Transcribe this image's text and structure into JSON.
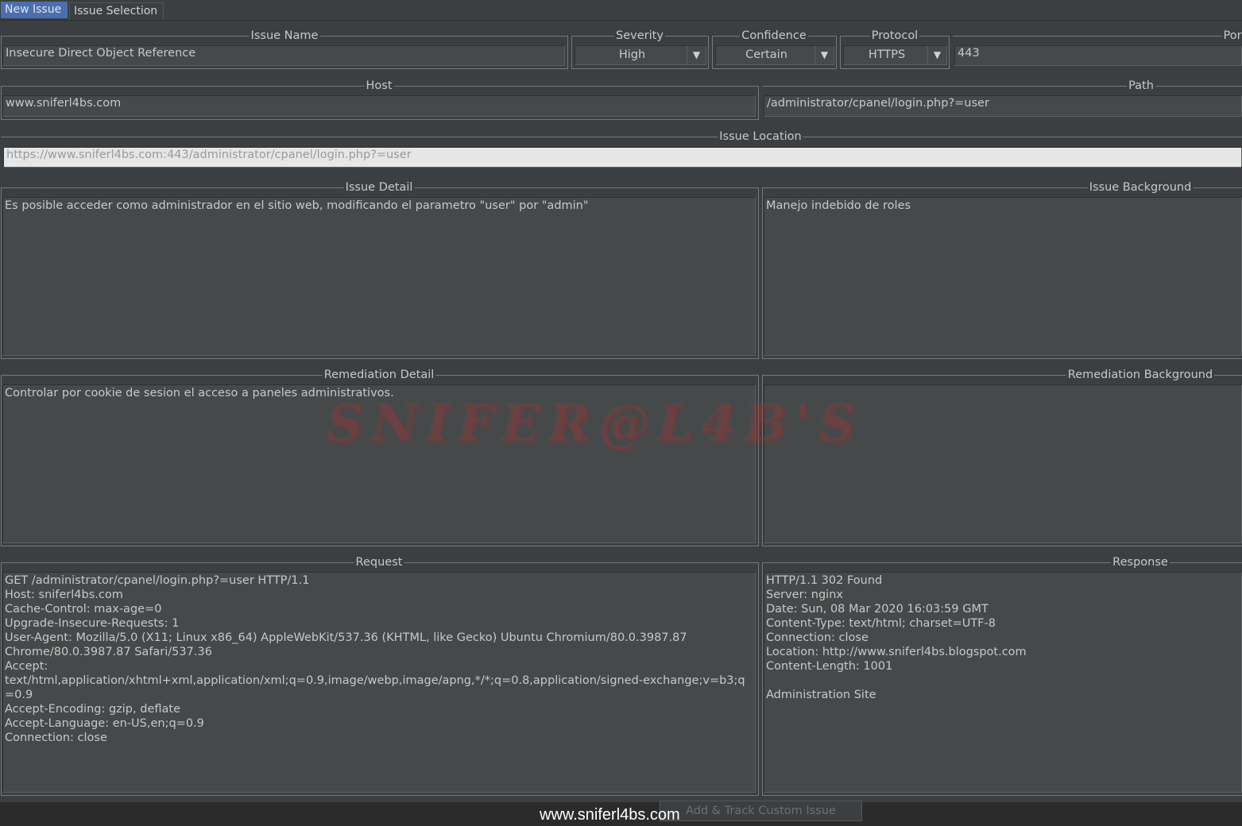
{
  "tabs": {
    "new_issue": "New Issue",
    "issue_selection": "Issue Selection"
  },
  "issue_name": {
    "label": "Issue Name",
    "value": "Insecure Direct Object Reference"
  },
  "severity": {
    "label": "Severity",
    "value": "High"
  },
  "confidence": {
    "label": "Confidence",
    "value": "Certain"
  },
  "protocol": {
    "label": "Protocol",
    "value": "HTTPS"
  },
  "port": {
    "label": "Por",
    "value": "443"
  },
  "host": {
    "label": "Host",
    "value": "www.sniferl4bs.com"
  },
  "path": {
    "label": "Path",
    "value": "/administrator/cpanel/login.php?=user"
  },
  "issue_location": {
    "label": "Issue Location",
    "value": "https://www.sniferl4bs.com:443/administrator/cpanel/login.php?=user"
  },
  "issue_detail": {
    "label": "Issue Detail",
    "value": "Es posible acceder como administrador en el sitio web, modificando el parametro \"user\" por \"admin\""
  },
  "issue_background": {
    "label": "Issue Background",
    "value": "Manejo indebido de roles"
  },
  "remediation_detail": {
    "label": "Remediation Detail",
    "value": "Controlar por cookie de sesion el acceso a paneles administrativos."
  },
  "remediation_background": {
    "label": "Remediation Background",
    "value": ""
  },
  "request": {
    "label": "Request",
    "value": "GET /administrator/cpanel/login.php?=user HTTP/1.1\nHost: sniferl4bs.com\nCache-Control: max-age=0\nUpgrade-Insecure-Requests: 1\nUser-Agent: Mozilla/5.0 (X11; Linux x86_64) AppleWebKit/537.36 (KHTML, like Gecko) Ubuntu Chromium/80.0.3987.87\nChrome/80.0.3987.87 Safari/537.36\nAccept:\ntext/html,application/xhtml+xml,application/xml;q=0.9,image/webp,image/apng,*/*;q=0.8,application/signed-exchange;v=b3;q\n=0.9\nAccept-Encoding: gzip, deflate\nAccept-Language: en-US,en;q=0.9\nConnection: close"
  },
  "response": {
    "label": "Response",
    "value": "HTTP/1.1 302 Found\nServer: nginx\nDate: Sun, 08 Mar 2020 16:03:59 GMT\nContent-Type: text/html; charset=UTF-8\nConnection: close\nLocation: http://www.sniferl4bs.blogspot.com\nContent-Length: 1001\n\nAdministration Site"
  },
  "add_button": "Add & Track Custom Issue",
  "watermark": "SNIFER@L4B'S",
  "site_caption": "www.sniferl4bs.com",
  "icons": {
    "dropdown": "chevron-down-icon"
  },
  "colors": {
    "background": "#3c3f41",
    "field": "#45494a",
    "active_tab": "#4b6eaf",
    "location_field": "#e6e6e6"
  }
}
